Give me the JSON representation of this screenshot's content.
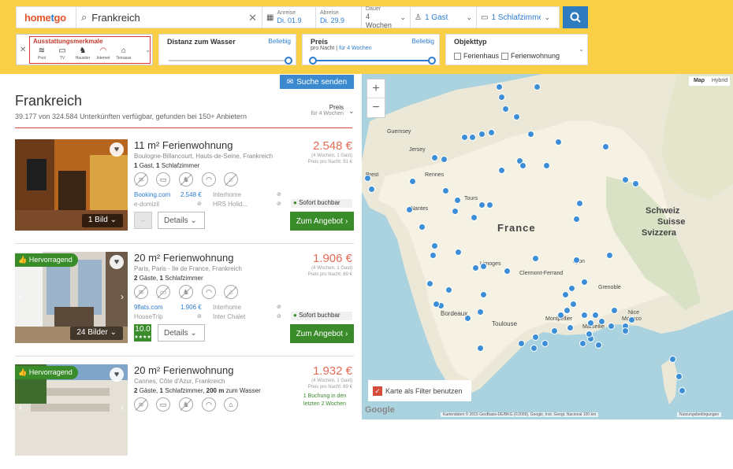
{
  "header": {
    "logo_pre": "home",
    "logo_o": "t",
    "logo_post": "go",
    "destination": "Frankreich",
    "arrival_label": "Anreise",
    "arrival_value": "Di. 01.9",
    "departure_label": "Abreise",
    "departure_value": "Di. 29.9",
    "duration_label": "Dauer",
    "duration_value": "4 Wochen",
    "guests": "1 Gast",
    "bedrooms": "1 Schlafzimmer"
  },
  "filters": {
    "amenities_title": "Ausstattungsmerkmale",
    "amenities": [
      {
        "icon": "pool-icon",
        "label": "Pool"
      },
      {
        "icon": "tv-icon",
        "label": "TV"
      },
      {
        "icon": "pet-icon",
        "label": "Haustier"
      },
      {
        "icon": "wifi-icon",
        "label": "Internet"
      },
      {
        "icon": "terrace-icon",
        "label": "Terrasse"
      }
    ],
    "water_label": "Distanz zum Wasser",
    "water_link": "Beliebig",
    "price_label": "Preis",
    "price_link": "Beliebig",
    "price_sub": "pro Nacht",
    "price_sub2": "für 4 Wochen",
    "object_label": "Objekttyp",
    "object_opt1": "Ferienhaus",
    "object_opt2": "Ferienwohnung"
  },
  "results": {
    "send_button": "Suche senden",
    "title": "Frankreich",
    "subtitle_pre": "39.177 von 324.584 Unterkünften verfügbar, gefunden bei 150+ Anbietern",
    "sort_label": "Preis",
    "sort_sub": "für 4 Wochen"
  },
  "listings": [
    {
      "title": "11 m² Ferienwohnung",
      "location": "Boulogne-Billancourt, Hauts-de-Seine, Frankreich",
      "guests_num": "1",
      "guests_txt": "Gast,",
      "rooms_num": "1",
      "rooms_txt": "Schlafzimmer",
      "price": "2.548 €",
      "weeks": "(4 Wochen, 1 Gast)",
      "per_night": "Preis pro Nacht: 91 €",
      "provider1": "Booking.com",
      "provider1_price": "2.548 €",
      "provider2": "Interhome",
      "provider3": "e-domizil",
      "provider4": "HRS Holid...",
      "image_count": "1 Bild",
      "details": "Details",
      "status": "Sofort buchbar",
      "cta": "Zum Angebot"
    },
    {
      "badge": "Hervorragend",
      "title": "20 m² Ferienwohnung",
      "location": "Paris, Paris - Ile de France, Frankreich",
      "guests_num": "2",
      "guests_txt": "Gäste,",
      "rooms_num": "1",
      "rooms_txt": "Schlafzimmer",
      "price": "1.906 €",
      "weeks": "(4 Wochen, 1 Gast)",
      "per_night": "Preis pro Nacht: 69 €",
      "provider1": "9flats.com",
      "provider1_price": "1.906 €",
      "provider2": "Interhome",
      "provider3": "HouseTrip",
      "provider4": "Inter Chalet",
      "image_count": "24 Bilder",
      "rating": "10.0",
      "rating_stars": "★★★★",
      "details": "Details",
      "status": "Sofort buchbar",
      "cta": "Zum Angebot"
    },
    {
      "badge": "Hervorragend",
      "title": "20 m² Ferienwohnung",
      "location": "Cannes, Côte d'Azur, Frankreich",
      "guests_num": "2",
      "guests_txt": "Gäste,",
      "rooms_num": "1",
      "rooms_txt": "Schlafzimmer,",
      "water_num": "200 m",
      "water_txt": "zum Wasser",
      "price": "1.932 €",
      "weeks": "(4 Wochen, 1 Gast)",
      "per_night": "Preis pro Nacht: 69 €",
      "booking_note": "1 Buchung in den letzten 2 Wochen"
    }
  ],
  "map": {
    "map_btn": "Map",
    "hybrid_btn": "Hybrid",
    "zoom_in": "+",
    "zoom_out": "−",
    "label_france": "France",
    "label_guernsey": "Guernsey",
    "label_jersey": "Jersey",
    "label_nantes": "Nantes",
    "label_bordeaux": "Bordeaux",
    "label_toulouse": "Toulouse",
    "label_montpellier": "Montpellier",
    "label_marseille": "Marseille",
    "label_monaco": "Monaco",
    "label_schweiz": "Schweiz",
    "label_suisse": "Suisse",
    "label_svizzera": "Svizzera",
    "label_brest": "Brest",
    "label_rennes": "Rennes",
    "label_tours": "Tours",
    "label_limoges": "Limoges",
    "label_clermont": "Clermont-Ferrand",
    "label_lyon": "Lyon",
    "label_grenoble": "Grenoble",
    "label_nice": "Nice",
    "filter_checkbox": "Karte als Filter benutzen",
    "copyright": "Kartendaten © 2015 GeoBasis-DE/BKG (©2009), Google, Inst. Geogr. Nacional   100 km",
    "terms": "Nutzungsbedingungen",
    "google": "Google"
  }
}
